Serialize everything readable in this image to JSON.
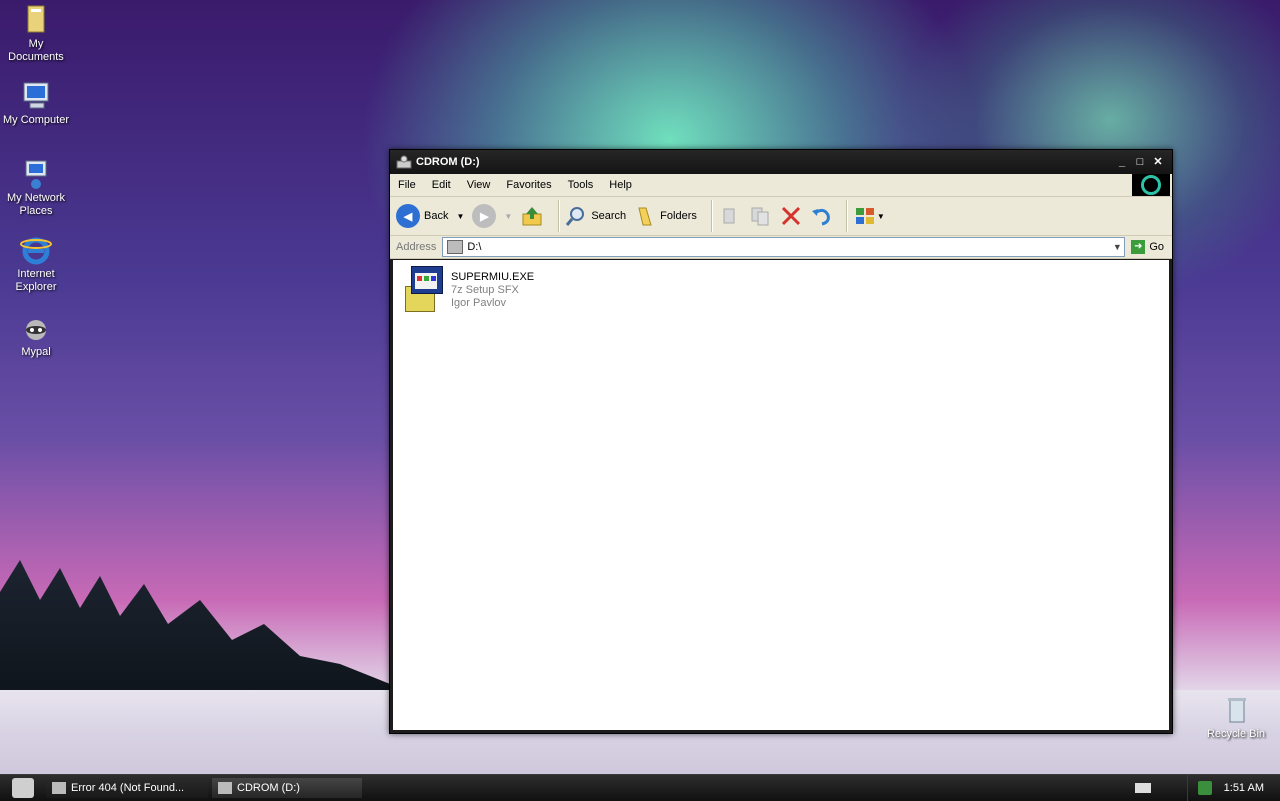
{
  "desktop": {
    "icons": [
      {
        "label": "My Documents",
        "icon": "my-documents-icon"
      },
      {
        "label": "My Computer",
        "icon": "my-computer-icon"
      },
      {
        "label": "My Network Places",
        "icon": "network-places-icon"
      },
      {
        "label": "Internet Explorer",
        "icon": "internet-explorer-icon"
      },
      {
        "label": "Mypal",
        "icon": "mypal-icon"
      }
    ],
    "recycle_bin": "Recycle Bin"
  },
  "window": {
    "title": "CDROM (D:)",
    "menu": [
      "File",
      "Edit",
      "View",
      "Favorites",
      "Tools",
      "Help"
    ],
    "toolbar": {
      "back": "Back",
      "search": "Search",
      "folders": "Folders"
    },
    "address": {
      "label": "Address",
      "value": "D:\\",
      "go": "Go"
    },
    "files": [
      {
        "name": "SUPERMIU.EXE",
        "type": "7z Setup SFX",
        "company": "Igor Pavlov"
      }
    ]
  },
  "taskbar": {
    "tasks": [
      "Error 404 (Not Found...",
      "CDROM (D:)"
    ],
    "clock": "1:51 AM"
  },
  "colors": {
    "window_chrome": "#1c1c1c",
    "menu_bg": "#ece9d8",
    "taskbar": "#101010"
  }
}
